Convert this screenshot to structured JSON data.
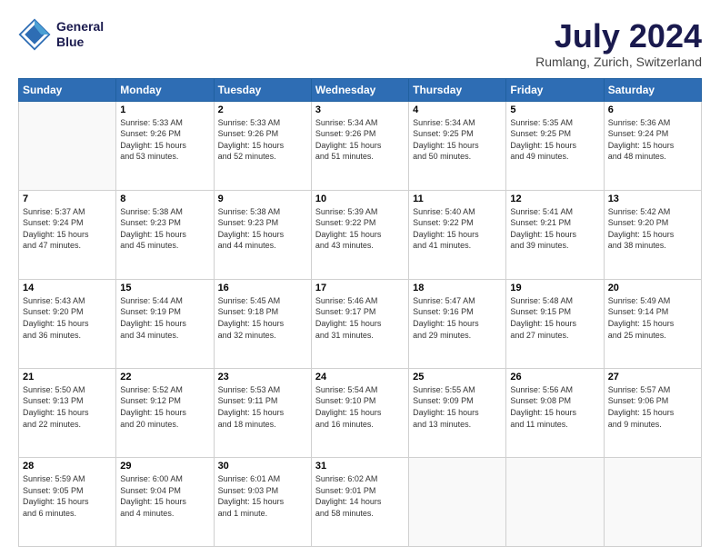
{
  "header": {
    "logo_line1": "General",
    "logo_line2": "Blue",
    "month": "July 2024",
    "location": "Rumlang, Zurich, Switzerland"
  },
  "weekdays": [
    "Sunday",
    "Monday",
    "Tuesday",
    "Wednesday",
    "Thursday",
    "Friday",
    "Saturday"
  ],
  "weeks": [
    [
      {
        "day": "",
        "info": ""
      },
      {
        "day": "1",
        "info": "Sunrise: 5:33 AM\nSunset: 9:26 PM\nDaylight: 15 hours\nand 53 minutes."
      },
      {
        "day": "2",
        "info": "Sunrise: 5:33 AM\nSunset: 9:26 PM\nDaylight: 15 hours\nand 52 minutes."
      },
      {
        "day": "3",
        "info": "Sunrise: 5:34 AM\nSunset: 9:26 PM\nDaylight: 15 hours\nand 51 minutes."
      },
      {
        "day": "4",
        "info": "Sunrise: 5:34 AM\nSunset: 9:25 PM\nDaylight: 15 hours\nand 50 minutes."
      },
      {
        "day": "5",
        "info": "Sunrise: 5:35 AM\nSunset: 9:25 PM\nDaylight: 15 hours\nand 49 minutes."
      },
      {
        "day": "6",
        "info": "Sunrise: 5:36 AM\nSunset: 9:24 PM\nDaylight: 15 hours\nand 48 minutes."
      }
    ],
    [
      {
        "day": "7",
        "info": "Sunrise: 5:37 AM\nSunset: 9:24 PM\nDaylight: 15 hours\nand 47 minutes."
      },
      {
        "day": "8",
        "info": "Sunrise: 5:38 AM\nSunset: 9:23 PM\nDaylight: 15 hours\nand 45 minutes."
      },
      {
        "day": "9",
        "info": "Sunrise: 5:38 AM\nSunset: 9:23 PM\nDaylight: 15 hours\nand 44 minutes."
      },
      {
        "day": "10",
        "info": "Sunrise: 5:39 AM\nSunset: 9:22 PM\nDaylight: 15 hours\nand 43 minutes."
      },
      {
        "day": "11",
        "info": "Sunrise: 5:40 AM\nSunset: 9:22 PM\nDaylight: 15 hours\nand 41 minutes."
      },
      {
        "day": "12",
        "info": "Sunrise: 5:41 AM\nSunset: 9:21 PM\nDaylight: 15 hours\nand 39 minutes."
      },
      {
        "day": "13",
        "info": "Sunrise: 5:42 AM\nSunset: 9:20 PM\nDaylight: 15 hours\nand 38 minutes."
      }
    ],
    [
      {
        "day": "14",
        "info": "Sunrise: 5:43 AM\nSunset: 9:20 PM\nDaylight: 15 hours\nand 36 minutes."
      },
      {
        "day": "15",
        "info": "Sunrise: 5:44 AM\nSunset: 9:19 PM\nDaylight: 15 hours\nand 34 minutes."
      },
      {
        "day": "16",
        "info": "Sunrise: 5:45 AM\nSunset: 9:18 PM\nDaylight: 15 hours\nand 32 minutes."
      },
      {
        "day": "17",
        "info": "Sunrise: 5:46 AM\nSunset: 9:17 PM\nDaylight: 15 hours\nand 31 minutes."
      },
      {
        "day": "18",
        "info": "Sunrise: 5:47 AM\nSunset: 9:16 PM\nDaylight: 15 hours\nand 29 minutes."
      },
      {
        "day": "19",
        "info": "Sunrise: 5:48 AM\nSunset: 9:15 PM\nDaylight: 15 hours\nand 27 minutes."
      },
      {
        "day": "20",
        "info": "Sunrise: 5:49 AM\nSunset: 9:14 PM\nDaylight: 15 hours\nand 25 minutes."
      }
    ],
    [
      {
        "day": "21",
        "info": "Sunrise: 5:50 AM\nSunset: 9:13 PM\nDaylight: 15 hours\nand 22 minutes."
      },
      {
        "day": "22",
        "info": "Sunrise: 5:52 AM\nSunset: 9:12 PM\nDaylight: 15 hours\nand 20 minutes."
      },
      {
        "day": "23",
        "info": "Sunrise: 5:53 AM\nSunset: 9:11 PM\nDaylight: 15 hours\nand 18 minutes."
      },
      {
        "day": "24",
        "info": "Sunrise: 5:54 AM\nSunset: 9:10 PM\nDaylight: 15 hours\nand 16 minutes."
      },
      {
        "day": "25",
        "info": "Sunrise: 5:55 AM\nSunset: 9:09 PM\nDaylight: 15 hours\nand 13 minutes."
      },
      {
        "day": "26",
        "info": "Sunrise: 5:56 AM\nSunset: 9:08 PM\nDaylight: 15 hours\nand 11 minutes."
      },
      {
        "day": "27",
        "info": "Sunrise: 5:57 AM\nSunset: 9:06 PM\nDaylight: 15 hours\nand 9 minutes."
      }
    ],
    [
      {
        "day": "28",
        "info": "Sunrise: 5:59 AM\nSunset: 9:05 PM\nDaylight: 15 hours\nand 6 minutes."
      },
      {
        "day": "29",
        "info": "Sunrise: 6:00 AM\nSunset: 9:04 PM\nDaylight: 15 hours\nand 4 minutes."
      },
      {
        "day": "30",
        "info": "Sunrise: 6:01 AM\nSunset: 9:03 PM\nDaylight: 15 hours\nand 1 minute."
      },
      {
        "day": "31",
        "info": "Sunrise: 6:02 AM\nSunset: 9:01 PM\nDaylight: 14 hours\nand 58 minutes."
      },
      {
        "day": "",
        "info": ""
      },
      {
        "day": "",
        "info": ""
      },
      {
        "day": "",
        "info": ""
      }
    ]
  ]
}
